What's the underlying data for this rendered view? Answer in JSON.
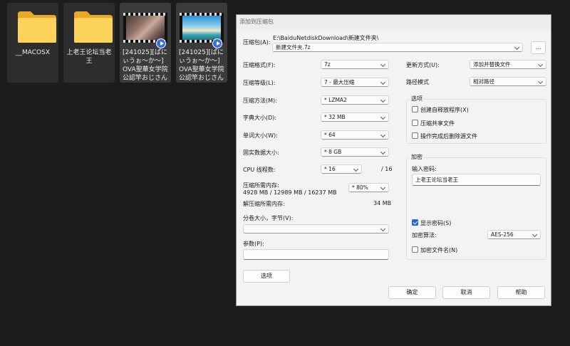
{
  "desktop": {
    "files": [
      {
        "name": "__MACOSX",
        "type": "folder"
      },
      {
        "name": "上老王论坛当老王",
        "type": "folder"
      },
      {
        "name": "[241025][ぱにぃうぉ～か～]OVA聖華女学院公認竿おじさん #...",
        "type": "video"
      },
      {
        "name": "[241025][ぱにぃうぉ～か～]OVA聖華女学院公認竿おじさん #...",
        "type": "video"
      }
    ]
  },
  "dialog": {
    "title": "添加到压缩包",
    "archive_label": "压缩包(A):",
    "archive_path": "E:\\BaiduNetdiskDownload\\新建文件夹\\",
    "archive_name": "新建文件夹.7z",
    "browse_label": "...",
    "format_label": "压缩格式(F):",
    "format_value": "7z",
    "level_label": "压缩等级(L):",
    "level_value": "7 - 最大压缩",
    "method_label": "压缩方法(M):",
    "method_value": "* LZMA2",
    "dict_label": "字典大小(D):",
    "dict_value": "* 32 MB",
    "word_label": "单词大小(W):",
    "word_value": "* 64",
    "solid_label": "固实数据大小:",
    "solid_value": "* 8 GB",
    "threads_label": "CPU 线程数:",
    "threads_value": "* 16",
    "threads_total": "/ 16",
    "mem_label": "压缩所需内存:",
    "mem_value": "4928 MB / 12989 MB / 16237 MB",
    "mem_percent": "* 80%",
    "decomp_label": "解压缩所需内存:",
    "decomp_value": "34 MB",
    "split_label": "分卷大小，字节(V):",
    "split_value": "",
    "params_label": "参数(P):",
    "params_value": "",
    "options_button": "选项",
    "update_label": "更新方式(U):",
    "update_value": "添加并替换文件",
    "pathmode_label": "路径模式",
    "pathmode_value": "相对路径",
    "options_group": "选项",
    "opt_sfx": "创建自释放程序(X)",
    "opt_shared": "压缩共享文件",
    "opt_delete": "操作完成后删除源文件",
    "encrypt_group": "加密",
    "password_label": "输入密码:",
    "password_value": "上老王论坛当老王",
    "show_password": "显示密码(S)",
    "enc_method_label": "加密算法:",
    "enc_method_value": "AES-256",
    "encrypt_names": "加密文件名(N)",
    "ok": "确定",
    "cancel": "取消",
    "help": "帮助"
  },
  "colors": {
    "accent": "#2d63d0",
    "desktop_bg": "#1c1c1c",
    "folder": "#f7c948"
  }
}
